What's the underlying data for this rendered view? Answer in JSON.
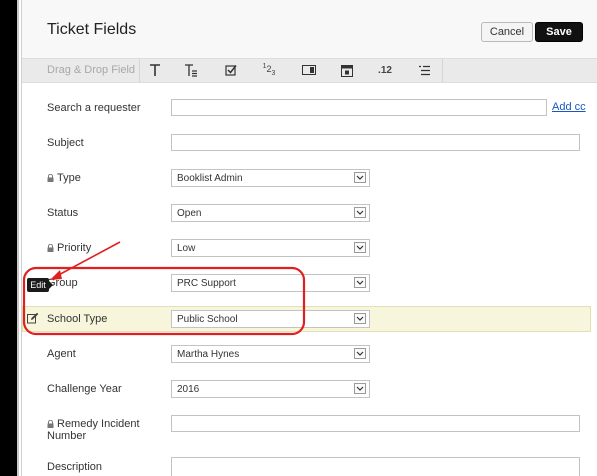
{
  "header": {
    "title": "Ticket Fields",
    "cancel_label": "Cancel",
    "save_label": "Save"
  },
  "toolbar": {
    "label": "Drag & Drop Field",
    "icons": [
      "text-field-icon",
      "multiline-text-icon",
      "checkbox-icon",
      "numeric-icon",
      "dropdown-icon",
      "date-icon",
      "decimal-icon",
      "multiselect-icon"
    ],
    "numeric_glyph": "123",
    "decimal_glyph": ".12"
  },
  "fields": {
    "search_requester": {
      "label": "Search a requester",
      "value": ""
    },
    "add_cc": "Add cc",
    "subject": {
      "label": "Subject",
      "value": ""
    },
    "type": {
      "label": "Type",
      "value": "Booklist Admin"
    },
    "status": {
      "label": "Status",
      "value": "Open"
    },
    "priority": {
      "label": "Priority",
      "value": "Low"
    },
    "group": {
      "label": "Group",
      "value": "PRC Support"
    },
    "school_type": {
      "label": "School Type",
      "value": "Public School"
    },
    "agent": {
      "label": "Agent",
      "value": "Martha Hynes"
    },
    "challenge_year": {
      "label": "Challenge Year",
      "value": "2016"
    },
    "remedy_incident": {
      "label": "Remedy Incident Number",
      "value": ""
    },
    "description": {
      "label": "Description",
      "value": ""
    }
  },
  "tooltip": {
    "edit": "Edit"
  },
  "colors": {
    "annotation": "#e02020",
    "highlight": "#f7f6dc",
    "link": "#1a55c4",
    "save_bg": "#111111"
  }
}
